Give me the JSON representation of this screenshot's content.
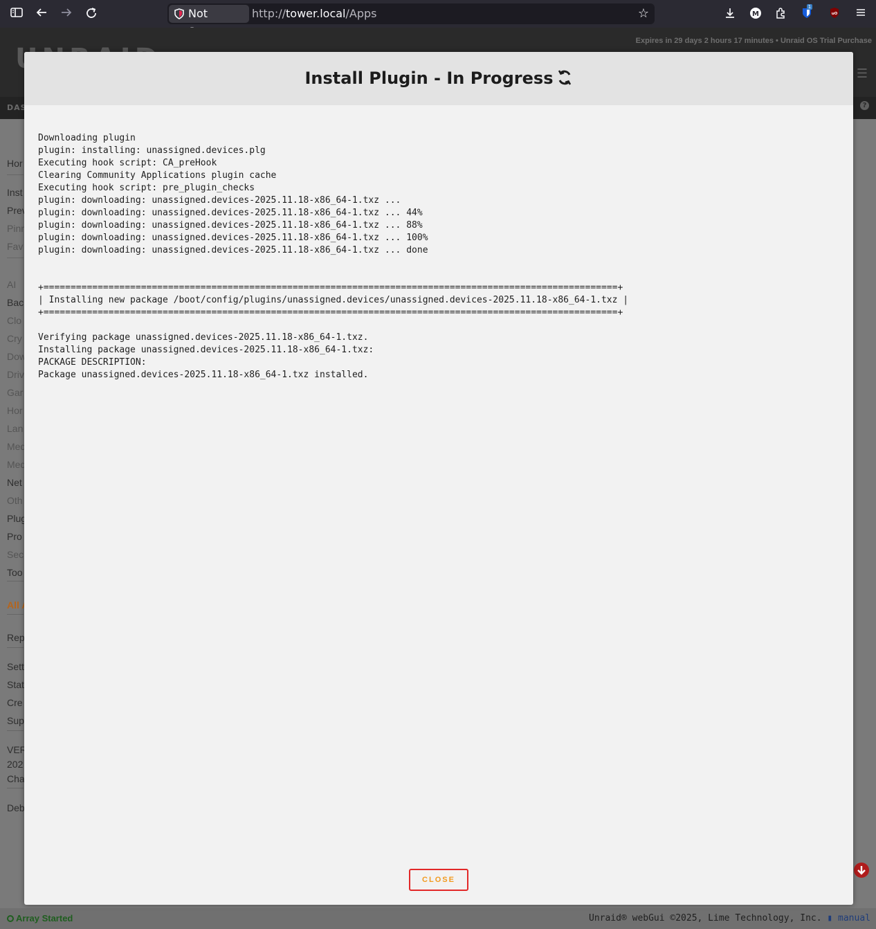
{
  "browser": {
    "security_label": "Not Secure",
    "url_scheme": "http://",
    "url_host": "tower.local",
    "url_path": "/Apps",
    "extension_badge": "1"
  },
  "page": {
    "logo": "UNRAID",
    "trial": "Expires in 29 days 2 hours 17 minutes  •  Unraid OS Trial Purchase",
    "nav_first": "DAS",
    "sidebar": [
      {
        "label": "Hor",
        "style": "normal"
      },
      {
        "label": "Inst",
        "style": "normal"
      },
      {
        "label": "Prev",
        "style": "normal"
      },
      {
        "label": "Pinn",
        "style": "muted"
      },
      {
        "label": "Fav",
        "style": "muted"
      },
      {
        "label": "AI",
        "style": "muted"
      },
      {
        "label": "Bac",
        "style": "normal"
      },
      {
        "label": "Clo",
        "style": "muted"
      },
      {
        "label": "Cry",
        "style": "muted"
      },
      {
        "label": "Dow",
        "style": "muted"
      },
      {
        "label": "Driv",
        "style": "muted"
      },
      {
        "label": "Gar",
        "style": "muted"
      },
      {
        "label": "Hor",
        "style": "muted"
      },
      {
        "label": "Lan",
        "style": "muted"
      },
      {
        "label": "Med",
        "style": "muted"
      },
      {
        "label": "Med",
        "style": "muted"
      },
      {
        "label": "Net",
        "style": "normal"
      },
      {
        "label": "Oth",
        "style": "muted"
      },
      {
        "label": "Plug",
        "style": "normal"
      },
      {
        "label": "Pro",
        "style": "normal"
      },
      {
        "label": "Sec",
        "style": "muted"
      },
      {
        "label": "Too",
        "style": "normal"
      },
      {
        "label": "All A",
        "style": "accent"
      },
      {
        "label": "Rep",
        "style": "normal"
      },
      {
        "label": "Sett",
        "style": "normal"
      },
      {
        "label": "Stat",
        "style": "normal"
      },
      {
        "label": "Cre",
        "style": "normal"
      },
      {
        "label": "Sup",
        "style": "normal"
      },
      {
        "label": "VER",
        "style": "normal"
      },
      {
        "label": "202",
        "style": "normal"
      },
      {
        "label": "Cha",
        "style": "normal"
      },
      {
        "label": "Deb",
        "style": "normal"
      }
    ],
    "status": "Array Started",
    "copyright": "Unraid® webGui ©2025, Lime Technology, Inc.",
    "manual": "manual"
  },
  "modal": {
    "title": "Install Plugin - In Progress",
    "close_label": "CLOSE",
    "log": [
      "Downloading plugin",
      "plugin: installing: unassigned.devices.plg",
      "Executing hook script: CA_preHook",
      "Clearing Community Applications plugin cache",
      "Executing hook script: pre_plugin_checks",
      "plugin: downloading: unassigned.devices-2025.11.18-x86_64-1.txz ...",
      "plugin: downloading: unassigned.devices-2025.11.18-x86_64-1.txz ... 44%",
      "plugin: downloading: unassigned.devices-2025.11.18-x86_64-1.txz ... 88%",
      "plugin: downloading: unassigned.devices-2025.11.18-x86_64-1.txz ... 100%",
      "plugin: downloading: unassigned.devices-2025.11.18-x86_64-1.txz ... done",
      "",
      "",
      "+==========================================================================================================+",
      "| Installing new package /boot/config/plugins/unassigned.devices/unassigned.devices-2025.11.18-x86_64-1.txz |",
      "+==========================================================================================================+",
      "",
      "Verifying package unassigned.devices-2025.11.18-x86_64-1.txz.",
      "Installing package unassigned.devices-2025.11.18-x86_64-1.txz:",
      "PACKAGE DESCRIPTION:",
      "Package unassigned.devices-2025.11.18-x86_64-1.txz installed."
    ]
  }
}
